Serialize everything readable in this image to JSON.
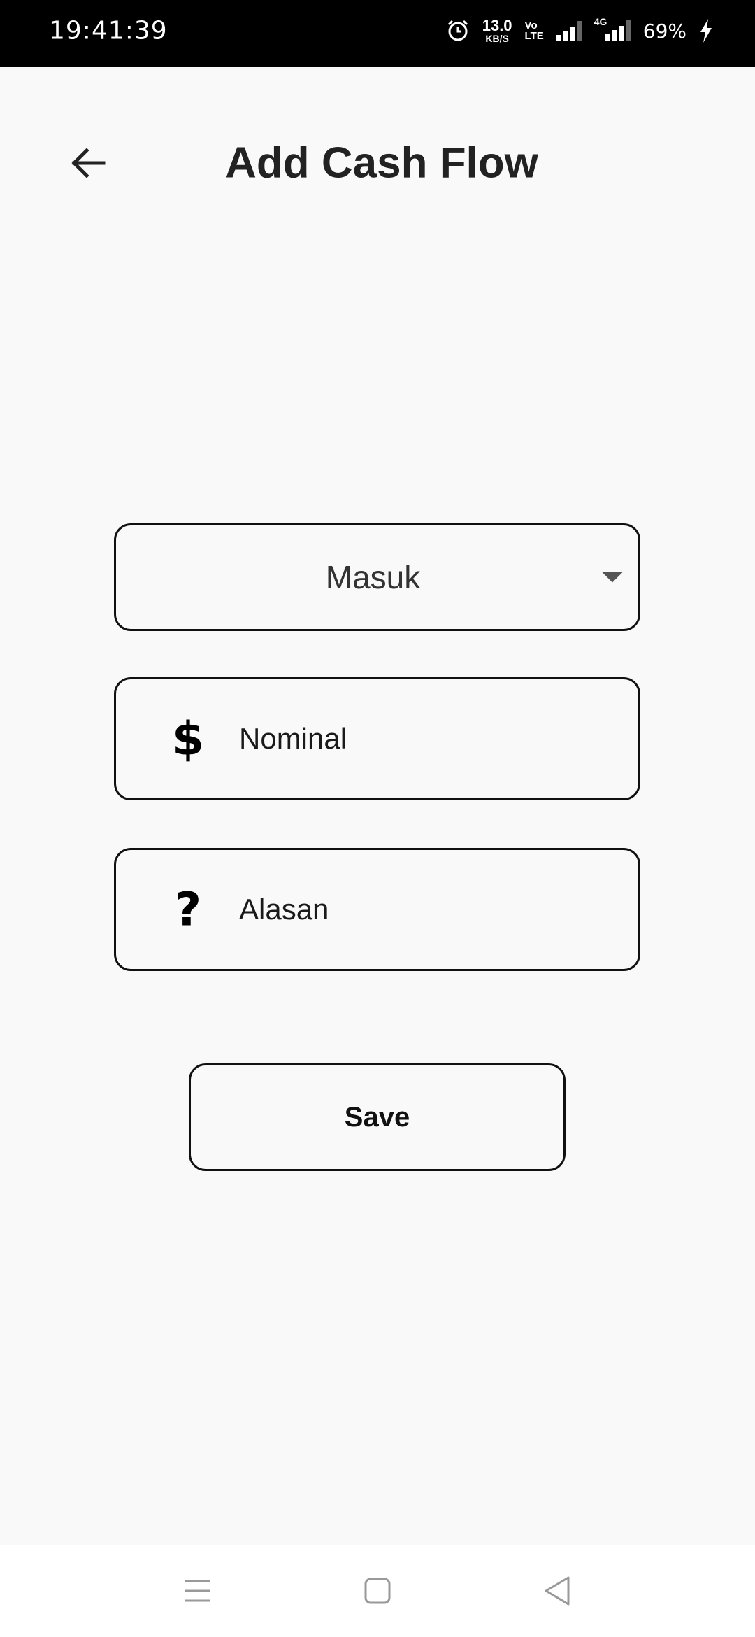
{
  "status_bar": {
    "time": "19:41:39",
    "net_speed_value": "13.0",
    "net_speed_unit": "KB/S",
    "volte_top": "Vo",
    "volte_bottom": "LTE",
    "network_type": "4G",
    "battery": "69%",
    "icons": [
      "alarm-icon",
      "signal-icon",
      "signal-4g-icon",
      "charging-bolt-icon"
    ]
  },
  "header": {
    "title": "Add Cash Flow",
    "back_icon": "arrow-left-icon"
  },
  "form": {
    "type_dropdown": {
      "selected": "Masuk",
      "icon": "caret-down-icon"
    },
    "nominal": {
      "icon_glyph": "$",
      "placeholder": "Nominal"
    },
    "reason": {
      "icon_glyph": "?",
      "placeholder": "Alasan"
    },
    "save_label": "Save"
  },
  "nav_bar": {
    "icons": [
      "menu-icon",
      "home-square-icon",
      "back-triangle-icon"
    ]
  },
  "colors": {
    "background": "#f9f9f9",
    "status_bar": "#000000",
    "border": "#111111",
    "nav_bar": "#ffffff"
  }
}
